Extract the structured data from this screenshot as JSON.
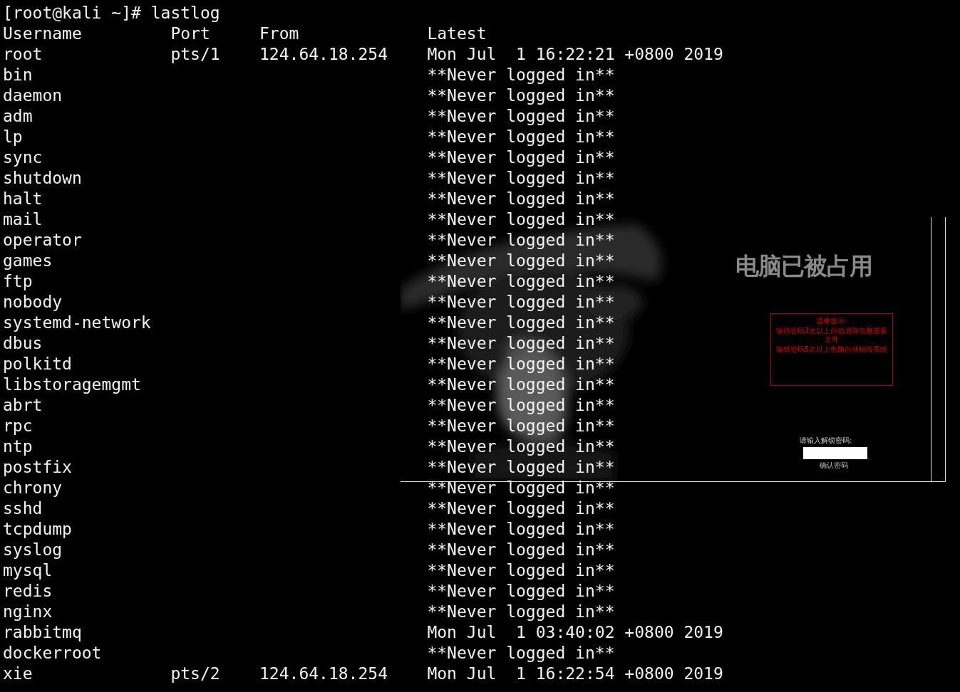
{
  "terminal": {
    "command_line": "[root@kali ~]# lastlog",
    "columns": [
      "Username",
      "Port",
      "From",
      "Latest"
    ],
    "rows": [
      {
        "username": "root",
        "port": "pts/1",
        "from": "124.64.18.254",
        "latest": "Mon Jul  1 16:22:21 +0800 2019"
      },
      {
        "username": "bin",
        "latest": "**Never logged in**"
      },
      {
        "username": "daemon",
        "latest": "**Never logged in**"
      },
      {
        "username": "adm",
        "latest": "**Never logged in**"
      },
      {
        "username": "lp",
        "latest": "**Never logged in**"
      },
      {
        "username": "sync",
        "latest": "**Never logged in**"
      },
      {
        "username": "shutdown",
        "latest": "**Never logged in**"
      },
      {
        "username": "halt",
        "latest": "**Never logged in**"
      },
      {
        "username": "mail",
        "latest": "**Never logged in**"
      },
      {
        "username": "operator",
        "latest": "**Never logged in**"
      },
      {
        "username": "games",
        "latest": "**Never logged in**"
      },
      {
        "username": "ftp",
        "latest": "**Never logged in**"
      },
      {
        "username": "nobody",
        "latest": "**Never logged in**"
      },
      {
        "username": "systemd-network",
        "latest": "**Never logged in**"
      },
      {
        "username": "dbus",
        "latest": "**Never logged in**"
      },
      {
        "username": "polkitd",
        "latest": "**Never logged in**"
      },
      {
        "username": "libstoragemgmt",
        "latest": "**Never logged in**"
      },
      {
        "username": "abrt",
        "latest": "**Never logged in**"
      },
      {
        "username": "rpc",
        "latest": "**Never logged in**"
      },
      {
        "username": "ntp",
        "latest": "**Never logged in**"
      },
      {
        "username": "postfix",
        "latest": "**Never logged in**"
      },
      {
        "username": "chrony",
        "latest": "**Never logged in**"
      },
      {
        "username": "sshd",
        "latest": "**Never logged in**"
      },
      {
        "username": "tcpdump",
        "latest": "**Never logged in**"
      },
      {
        "username": "syslog",
        "latest": "**Never logged in**"
      },
      {
        "username": "mysql",
        "latest": "**Never logged in**"
      },
      {
        "username": "redis",
        "latest": "**Never logged in**"
      },
      {
        "username": "nginx",
        "latest": "**Never logged in**"
      },
      {
        "username": "rabbitmq",
        "latest": "Mon Jul  1 03:40:02 +0800 2019"
      },
      {
        "username": "dockerroot",
        "latest": "**Never logged in**"
      },
      {
        "username": "xie",
        "port": "pts/2",
        "from": "124.64.18.254",
        "latest": "Mon Jul  1 16:22:54 +0800 2019"
      }
    ]
  },
  "lock_window": {
    "title": "电脑已被占用",
    "warning": {
      "heading": "温馨提示:",
      "lines": [
        "输错密码3次以上自动清除电脑重要文件",
        "输错密码5次以上电脑自动销毁系统"
      ]
    },
    "password_label": "请输入解锁密码:",
    "confirm_button": "确认密码"
  }
}
